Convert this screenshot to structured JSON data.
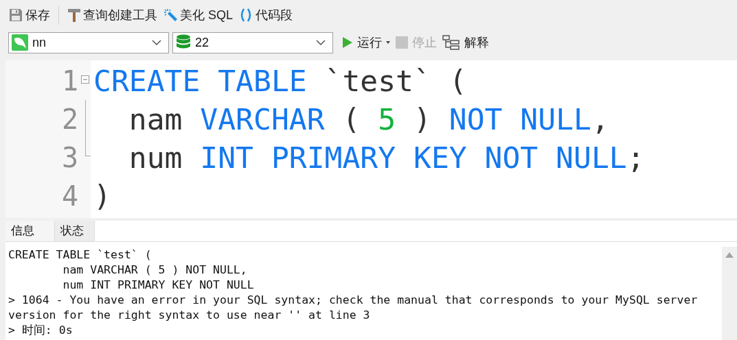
{
  "toolbar": [
    {
      "label": "保存",
      "kind": "save"
    },
    {
      "label": "查询创建工具",
      "kind": "hammer"
    },
    {
      "label": "美化 SQL",
      "kind": "wand"
    },
    {
      "label": "代码段",
      "kind": "braces"
    }
  ],
  "connection": {
    "value": "nn"
  },
  "database": {
    "value": "22"
  },
  "actions": [
    {
      "label": "运行",
      "kind": "run",
      "disabled": false,
      "menu": true
    },
    {
      "label": "停止",
      "kind": "stop",
      "disabled": true,
      "menu": false
    },
    {
      "label": "解释",
      "kind": "explain",
      "disabled": false,
      "menu": false
    }
  ],
  "editor": {
    "lines": [
      {
        "number": "1",
        "kind": "foldhead",
        "tokens": [
          {
            "text": "CREATE TABLE",
            "kind": "keyword"
          },
          {
            "text": " `test` (",
            "kind": "plain"
          }
        ]
      },
      {
        "number": "2",
        "kind": "foldbody",
        "tokens": [
          {
            "text": "  nam ",
            "kind": "plain"
          },
          {
            "text": "VARCHAR",
            "kind": "keyword"
          },
          {
            "text": " ( ",
            "kind": "plain"
          },
          {
            "text": "5",
            "kind": "number"
          },
          {
            "text": " ) ",
            "kind": "plain"
          },
          {
            "text": "NOT NULL",
            "kind": "keyword"
          },
          {
            "text": ",",
            "kind": "plain"
          }
        ]
      },
      {
        "number": "3",
        "kind": "foldtail",
        "tokens": [
          {
            "text": "  num ",
            "kind": "plain"
          },
          {
            "text": "INT PRIMARY KEY NOT NULL",
            "kind": "keyword"
          },
          {
            "text": ";",
            "kind": "plain"
          }
        ]
      },
      {
        "number": "4",
        "kind": "plain",
        "tokens": [
          {
            "text": ")",
            "kind": "plain"
          }
        ]
      }
    ]
  },
  "tabs": [
    {
      "label": "信息",
      "selected": true
    },
    {
      "label": "状态",
      "selected": false
    }
  ],
  "output": {
    "lines": [
      "CREATE TABLE `test` (",
      "        nam VARCHAR ( 5 ) NOT NULL,",
      "        num INT PRIMARY KEY NOT NULL",
      "> 1064 - You have an error in your SQL syntax; check the manual that corresponds to your MySQL server",
      "version for the right syntax to use near '' at line 3",
      "> 时间: 0s"
    ]
  }
}
